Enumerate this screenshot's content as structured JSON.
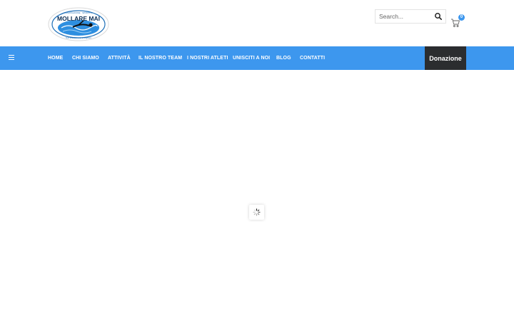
{
  "header": {
    "logo": {
      "icon": "swimmer-logo",
      "title": "MOLLARE MAI",
      "top_text": "ASSOCIAZIONE · SPORTIVA",
      "tagline": "Non smettere mai di sognare"
    },
    "search": {
      "placeholder": "Search...",
      "value": "",
      "icon": "search-icon"
    },
    "cart": {
      "count": "0",
      "icon": "cart-icon"
    }
  },
  "nav": {
    "menu_icon": "hamburger-icon",
    "items": [
      {
        "label": "HOME"
      },
      {
        "label": "CHI SIAMO"
      },
      {
        "label": "ATTIVITÀ"
      },
      {
        "label": "IL NOSTRO TEAM"
      },
      {
        "label": "I NOSTRI ATLETI"
      },
      {
        "label": "UNISCITI A NOI"
      },
      {
        "label": "BLOG"
      },
      {
        "label": "CONTATTI"
      }
    ],
    "donate_label": "Donazione"
  },
  "main": {
    "loader_icon": "spinner-icon"
  },
  "colors": {
    "nav_bg": "#3d97ee",
    "donate_bg": "#2b2d2f",
    "badge_bg": "#3d97ee"
  }
}
